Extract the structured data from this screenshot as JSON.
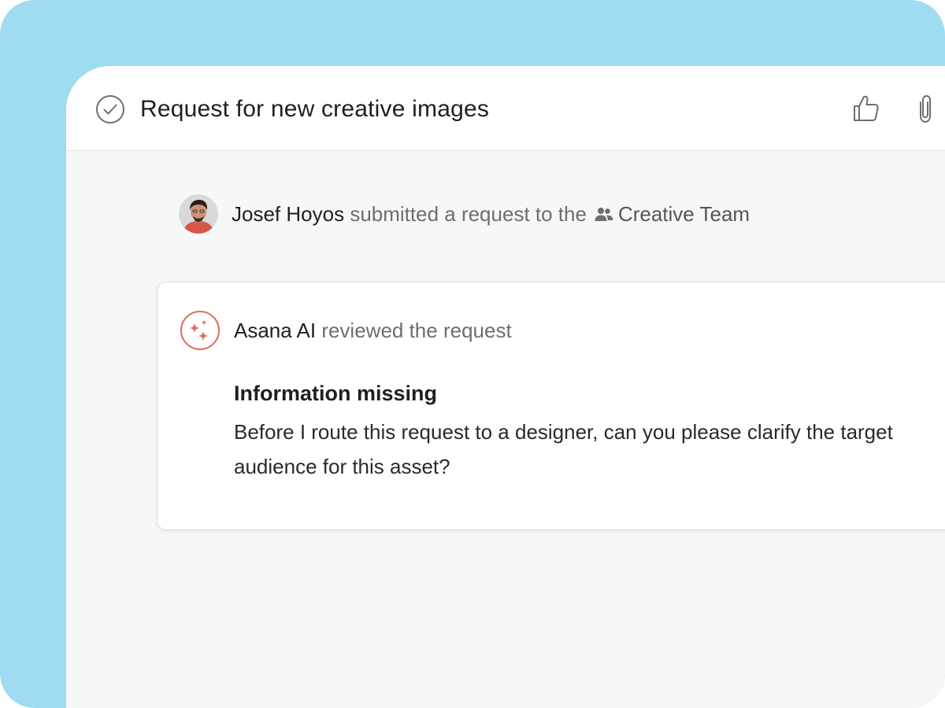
{
  "task": {
    "title": "Request for new creative images",
    "status_icon": "check-circle-icon",
    "actions": [
      {
        "name": "like-icon"
      },
      {
        "name": "attachment-icon"
      }
    ]
  },
  "activity": {
    "actor": "Josef Hoyos",
    "action_text": "submitted a request to the",
    "team_icon": "team-icon",
    "team_name": "Creative Team"
  },
  "ai_review": {
    "icon": "sparkles-icon",
    "actor": "Asana AI",
    "action_text": "reviewed the request",
    "heading": "Information missing",
    "body": "Before I route this request to a designer, can you please clarify the target audience for this asset?"
  },
  "colors": {
    "backdrop": "#9fdcf2",
    "panel_background": "#f7f7f7",
    "ai_accent": "#e06b5a",
    "muted_text": "#6d6e6f"
  }
}
